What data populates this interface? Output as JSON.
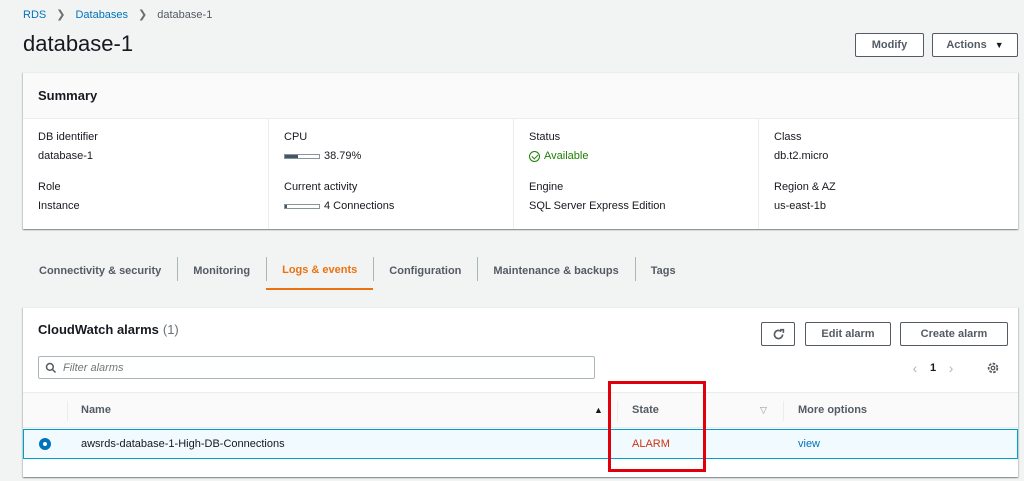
{
  "breadcrumb": [
    "RDS",
    "Databases",
    "database-1"
  ],
  "page_title": "database-1",
  "header_buttons": {
    "modify": "Modify",
    "actions": "Actions"
  },
  "summary": {
    "title": "Summary",
    "db_identifier_label": "DB identifier",
    "db_identifier": "database-1",
    "role_label": "Role",
    "role": "Instance",
    "cpu_label": "CPU",
    "cpu_value": "38.79%",
    "cpu_fraction": 0.3879,
    "activity_label": "Current activity",
    "activity_value": "4 Connections",
    "activity_fraction": 0.05,
    "status_label": "Status",
    "status_value": "Available",
    "engine_label": "Engine",
    "engine_value": "SQL Server Express Edition",
    "class_label": "Class",
    "class_value": "db.t2.micro",
    "region_label": "Region & AZ",
    "region_value": "us-east-1b"
  },
  "tabs": [
    {
      "label": "Connectivity & security"
    },
    {
      "label": "Monitoring"
    },
    {
      "label": "Logs & events",
      "active": true
    },
    {
      "label": "Configuration"
    },
    {
      "label": "Maintenance & backups"
    },
    {
      "label": "Tags"
    }
  ],
  "alarms": {
    "title": "CloudWatch alarms",
    "count": "(1)",
    "edit_label": "Edit alarm",
    "create_label": "Create alarm",
    "filter_placeholder": "Filter alarms",
    "page": "1",
    "columns": {
      "name": "Name",
      "state": "State",
      "more": "More options"
    },
    "rows": [
      {
        "name": "awsrds-database-1-High-DB-Connections",
        "state": "ALARM",
        "more": "view"
      }
    ]
  },
  "colors": {
    "accent": "#ec7211",
    "link": "#0073bb",
    "alarm": "#d13212",
    "ok": "#1d8102",
    "highlight": "#e0000c"
  }
}
